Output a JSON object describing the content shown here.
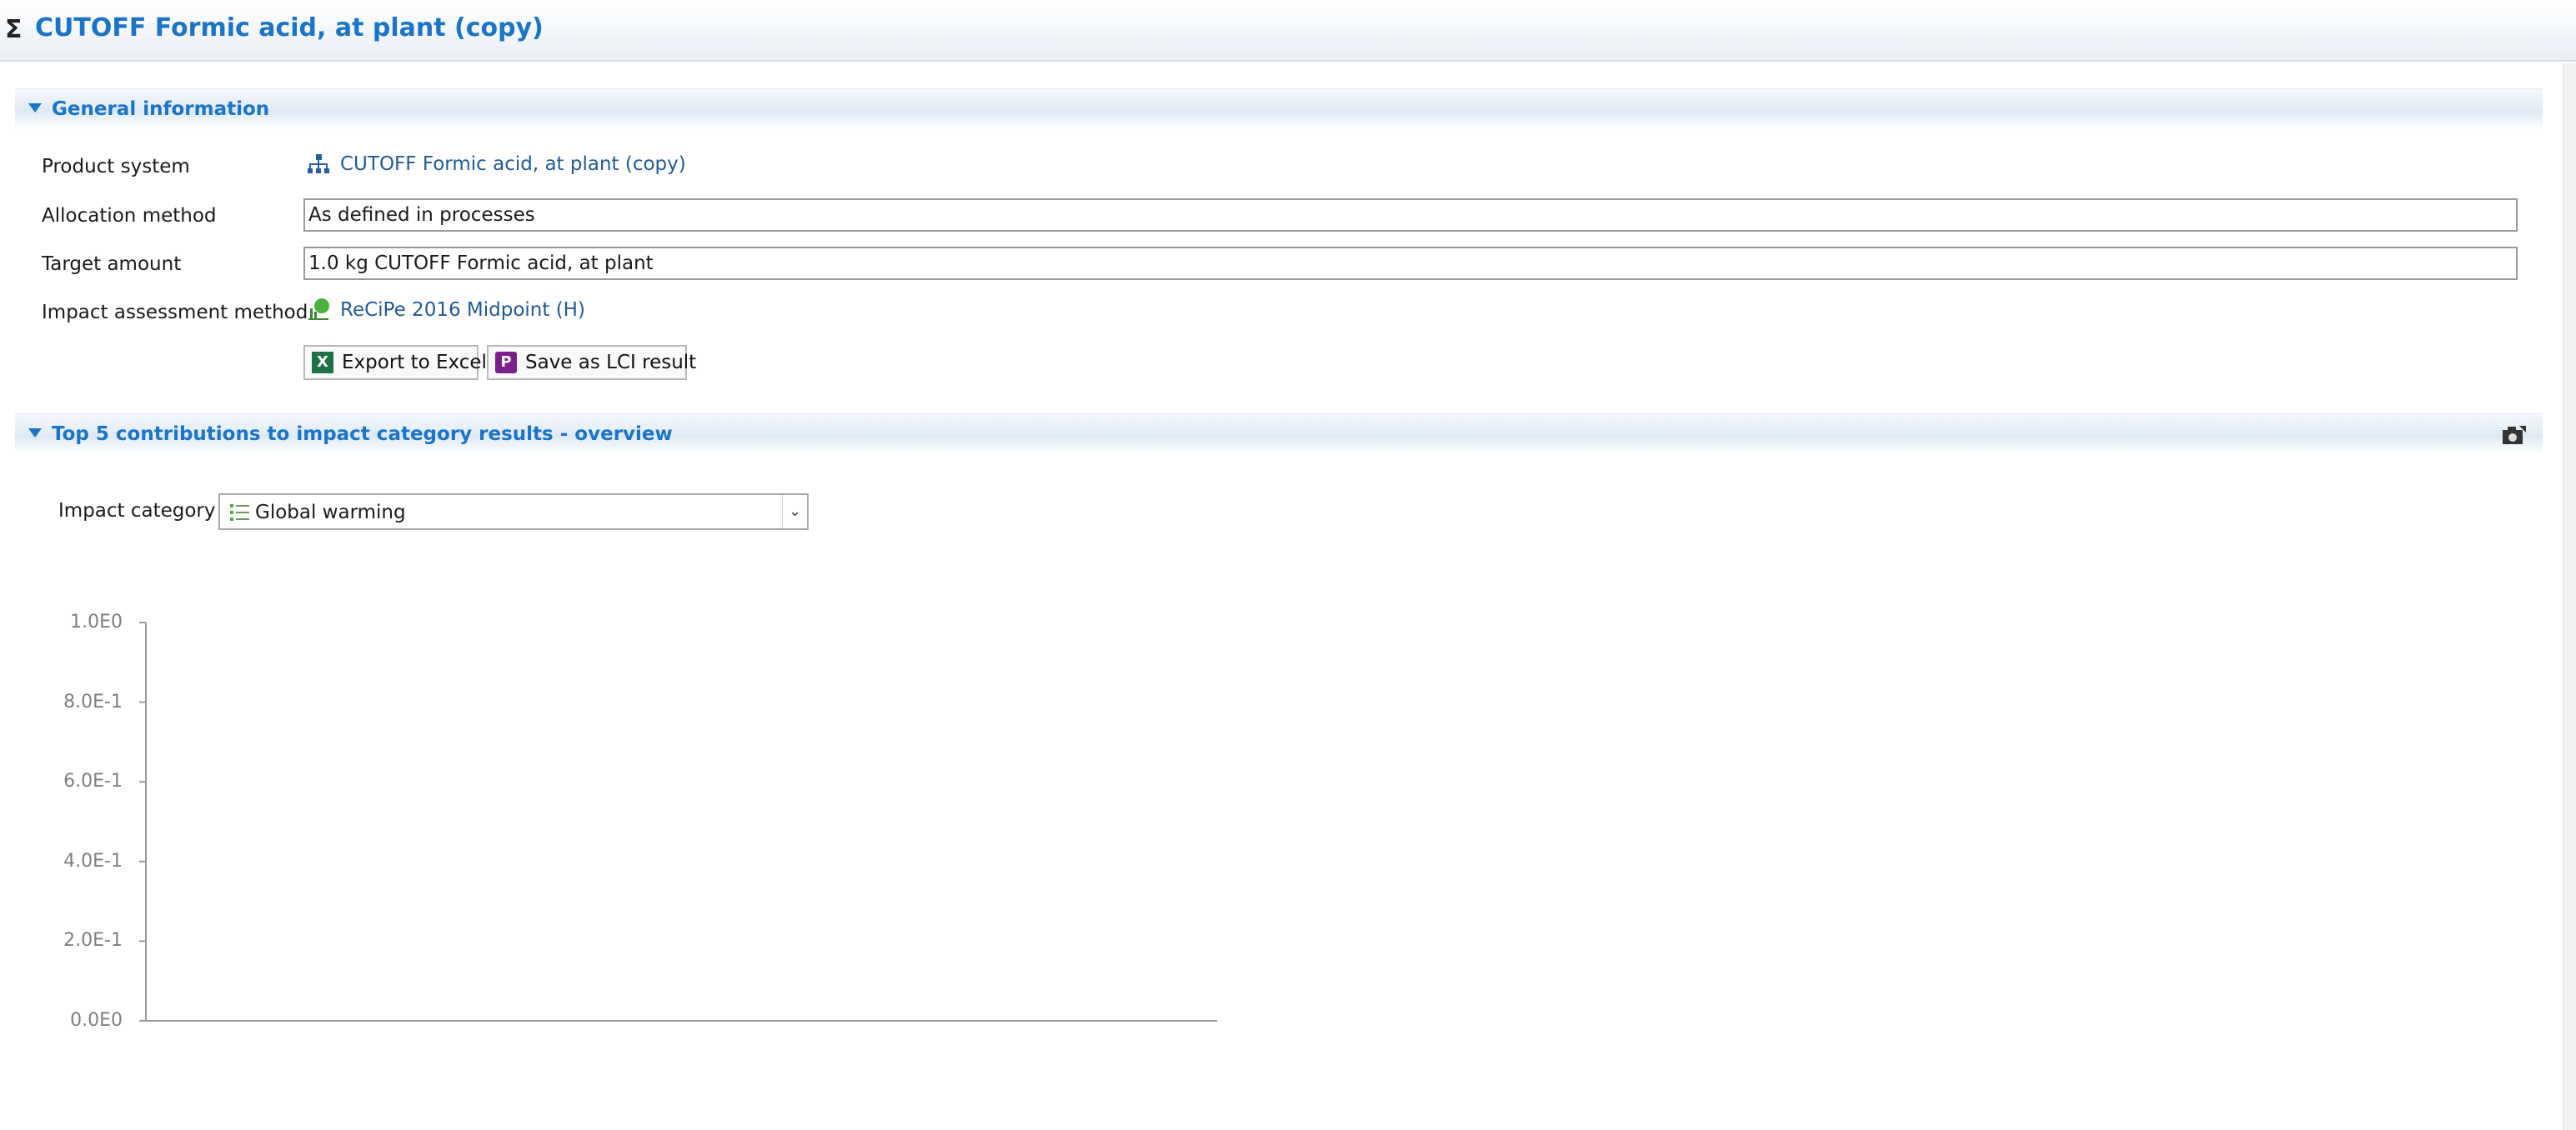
{
  "editor": {
    "sigma_glyph": "Σ",
    "title": "CUTOFF Formic acid, at plant (copy)"
  },
  "general_info": {
    "section_title": "General information",
    "product_system": {
      "label": "Product system",
      "value": "CUTOFF Formic acid, at plant (copy)",
      "icon": "product-system-icon"
    },
    "allocation_method": {
      "label": "Allocation method",
      "value": "As defined in processes"
    },
    "target_amount": {
      "label": "Target amount",
      "value": "1.0 kg CUTOFF Formic acid, at plant"
    },
    "impact_method": {
      "label": "Impact assessment method",
      "value": "ReCiPe 2016 Midpoint (H)",
      "icon": "impact-method-icon"
    },
    "buttons": {
      "export_excel": "Export to Excel",
      "excel_icon_letter": "X",
      "save_lci": "Save as LCI result",
      "save_lci_icon_letter": "P"
    }
  },
  "contributions": {
    "section_title": "Top 5 contributions to impact category results - overview",
    "impact_category_label": "Impact category",
    "impact_category_value": "Global warming",
    "dropdown_arrow": "⌄"
  },
  "chart_data": {
    "type": "bar",
    "title": "",
    "xlabel": "",
    "ylabel": "",
    "categories": [],
    "values": [],
    "ylim": [
      0,
      1
    ],
    "y_ticks": [
      "0.0E0",
      "2.0E-1",
      "4.0E-1",
      "6.0E-1",
      "8.0E-1",
      "1.0E0"
    ],
    "grid": false
  },
  "colors": {
    "title_blue": "#1b74c6",
    "link_blue": "#1f5b96",
    "excel_green": "#1e7145",
    "lci_purple": "#7a1f8c",
    "axis_gray": "#9a9a9a"
  }
}
